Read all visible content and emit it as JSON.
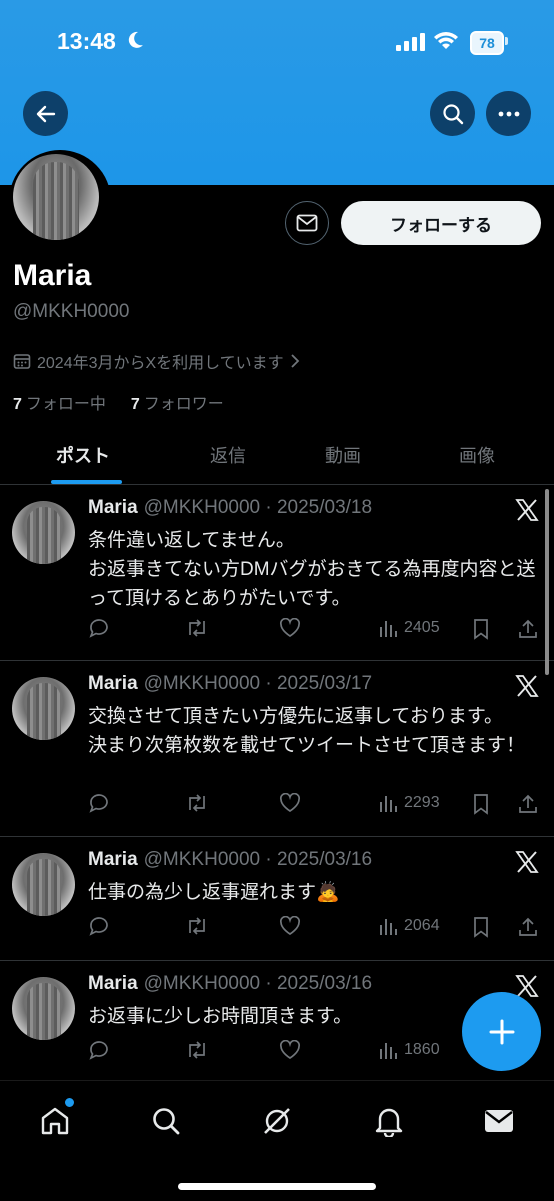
{
  "status_bar": {
    "time": "13:48",
    "battery": "78"
  },
  "profile": {
    "display_name": "Maria",
    "handle": "@MKKH0000",
    "joined": "2024年3月からXを利用しています",
    "following_count": "7",
    "following_label": "フォロー中",
    "followers_count": "7",
    "followers_label": "フォロワー",
    "follow_label": "フォローする"
  },
  "tabs": [
    {
      "label": "ポスト",
      "active": true
    },
    {
      "label": "返信"
    },
    {
      "label": "動画"
    },
    {
      "label": "画像"
    }
  ],
  "posts": [
    {
      "name": "Maria",
      "meta": "@MKKH0000 · 2025/03/18",
      "text": "条件違い返してません。\nお返事きてない方DMバグがおきてる為再度内容と送って頂けるとありがたいです。",
      "views": "2405"
    },
    {
      "name": "Maria",
      "meta": "@MKKH0000 · 2025/03/17",
      "text": "交換させて頂きたい方優先に返事しております。\n決まり次第枚数を載せてツイートさせて頂きます！",
      "views": "2293"
    },
    {
      "name": "Maria",
      "meta": "@MKKH0000 · 2025/03/16",
      "text": "仕事の為少し返事遅れます🙇",
      "views": "2064"
    },
    {
      "name": "Maria",
      "meta": "@MKKH0000 · 2025/03/16",
      "text": "お返事に少しお時間頂きます。",
      "views": "1860"
    }
  ],
  "colors": {
    "accent": "#1d9bf0",
    "banner": "#1d96e8",
    "secondary_text": "#71767b"
  }
}
